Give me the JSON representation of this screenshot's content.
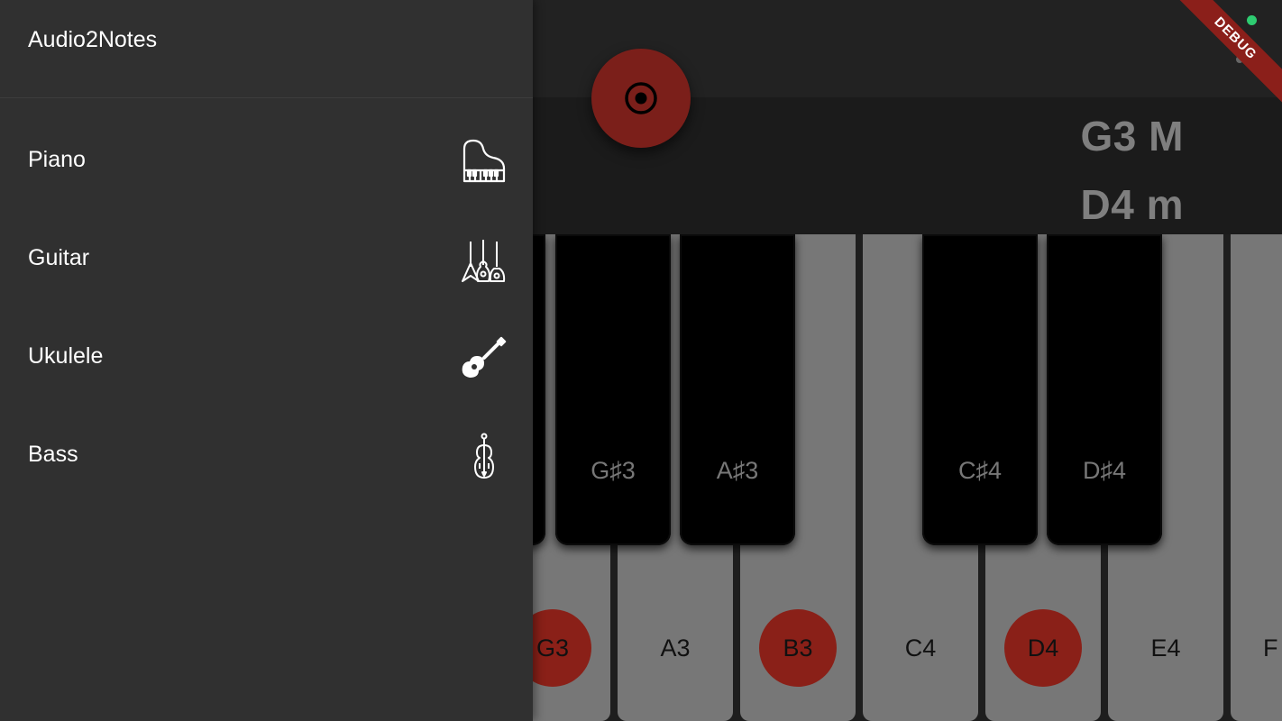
{
  "app": {
    "title": "Audio2Notes"
  },
  "drawer": {
    "items": [
      {
        "label": "Piano",
        "icon": "piano-icon"
      },
      {
        "label": "Guitar",
        "icon": "guitars-icon"
      },
      {
        "label": "Ukulele",
        "icon": "ukulele-icon"
      },
      {
        "label": "Bass",
        "icon": "double-bass-icon"
      }
    ]
  },
  "chords": {
    "first": "G3 M",
    "second": "D4 m"
  },
  "record_button": {
    "icon": "record-icon"
  },
  "keyboard": {
    "white_keys": [
      {
        "label": "G3",
        "highlighted": true
      },
      {
        "label": "A3",
        "highlighted": false
      },
      {
        "label": "B3",
        "highlighted": true
      },
      {
        "label": "C4",
        "highlighted": false
      },
      {
        "label": "D4",
        "highlighted": true
      },
      {
        "label": "E4",
        "highlighted": false
      },
      {
        "label": "F",
        "highlighted": false
      }
    ],
    "black_keys": [
      {
        "label": ""
      },
      {
        "label": "G♯3"
      },
      {
        "label": "A♯3"
      },
      {
        "label": "C♯4"
      },
      {
        "label": "D♯4"
      }
    ]
  },
  "debug_banner": {
    "label": "DEBUG"
  },
  "colors": {
    "highlight": "#8a2018",
    "white_key": "#777777",
    "black_key": "#000000",
    "drawer_bg": "#303030"
  }
}
